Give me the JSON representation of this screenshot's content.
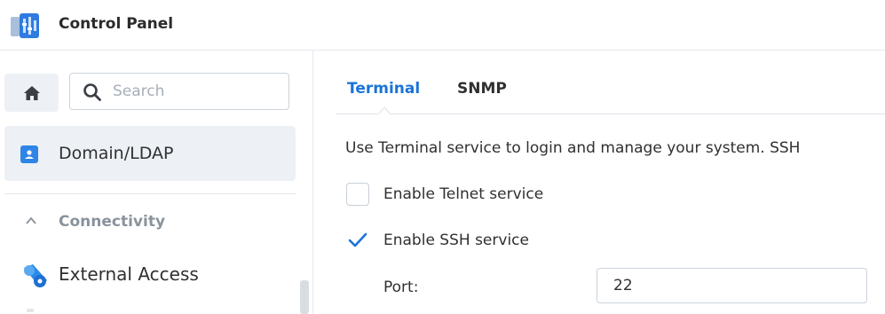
{
  "app": {
    "title": "Control Panel",
    "icon": "control-panel-app-icon"
  },
  "sidebar": {
    "home_icon": "home-icon",
    "search": {
      "placeholder": "Search",
      "value": "",
      "icon": "search-icon"
    },
    "items": [
      {
        "label": "Domain/LDAP",
        "icon": "id-card-icon",
        "active": true
      }
    ],
    "sections": [
      {
        "label": "Connectivity",
        "expanded": true,
        "items": [
          {
            "label": "External Access",
            "icon": "external-access-icon"
          }
        ]
      }
    ]
  },
  "main": {
    "tabs": [
      {
        "label": "Terminal",
        "active": true
      },
      {
        "label": "SNMP",
        "active": false
      }
    ],
    "description": "Use Terminal service to login and manage your system. SSH",
    "options": {
      "telnet": {
        "label": "Enable Telnet service",
        "checked": false
      },
      "ssh": {
        "label": "Enable SSH service",
        "checked": true
      }
    },
    "port": {
      "label": "Port:",
      "value": "22"
    }
  },
  "colors": {
    "accent": "#1b74d8",
    "active_item_bg": "#edf1f6",
    "section_header": "#8a939c",
    "text": "#303030"
  }
}
